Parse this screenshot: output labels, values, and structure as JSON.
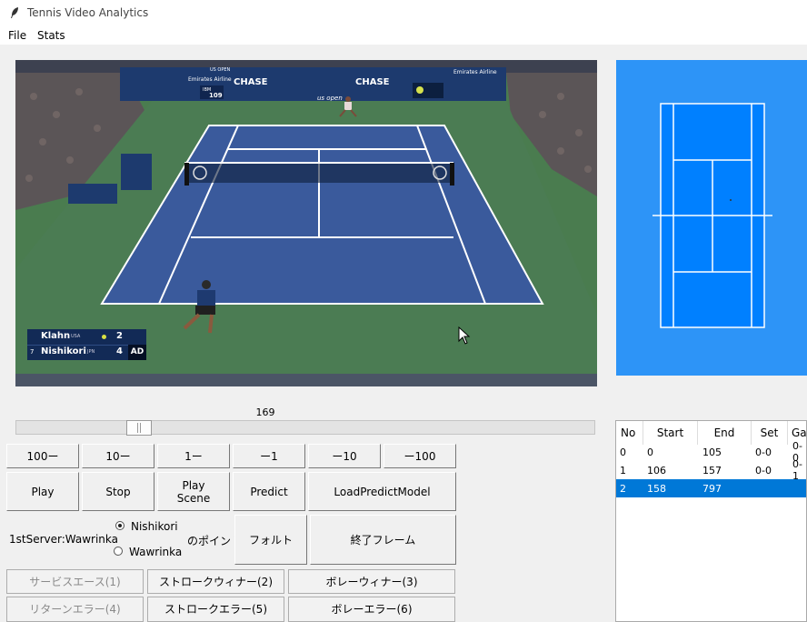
{
  "window": {
    "title": "Tennis Video Analytics"
  },
  "menu": [
    "File",
    "Stats"
  ],
  "video": {
    "ads": [
      "Emirates Airline",
      "CHASE",
      "CHASE",
      "Emirates Airline",
      "US OPEN",
      "IBM",
      "109",
      "us open"
    ],
    "scoreboard": {
      "players": [
        {
          "name": "Klahn",
          "country": "USA",
          "score": "2",
          "serving": true,
          "seed": ""
        },
        {
          "name": "Nishikori",
          "country": "JPN",
          "score": "4",
          "serving": false,
          "seed": "7",
          "extra": "AD"
        }
      ]
    }
  },
  "slider": {
    "value": "169",
    "fraction": 0.19
  },
  "nav_buttons": [
    "100ー",
    "10ー",
    "1ー",
    "ー1",
    "ー10",
    "ー100"
  ],
  "control_buttons": {
    "play": "Play",
    "stop": "Stop",
    "play_scene": "Play\nScene",
    "predict": "Predict",
    "load_model": "LoadPredictModel"
  },
  "server": {
    "label": "1stServer:Wawrinka",
    "options": [
      "Nishikori",
      "Wawrinka"
    ],
    "selected": 0,
    "point_label": "のポイント",
    "fault": "フォルト",
    "end_frame": "終了フレーム"
  },
  "shot_buttons": [
    [
      "サービスエース(1)",
      "ストロークウィナー(2)",
      "ボレーウィナー(3)"
    ],
    [
      "リターンエラー(4)",
      "ストロークエラー(5)",
      "ボレーエラー(6)"
    ]
  ],
  "table": {
    "columns": [
      "No",
      "Start",
      "End",
      "Set",
      "Gar"
    ],
    "rows": [
      [
        "0",
        "0",
        "105",
        "0-0",
        "0-0"
      ],
      [
        "1",
        "106",
        "157",
        "0-0",
        "0-1"
      ],
      [
        "2",
        "158",
        "797",
        "",
        ""
      ]
    ],
    "selected_row": 2
  },
  "colors": {
    "court_panel": "#2d94f7",
    "court": "#0080ff",
    "selection": "#0078d7",
    "video_court": "#3a5a9c",
    "video_surround": "#4a7c4f"
  }
}
